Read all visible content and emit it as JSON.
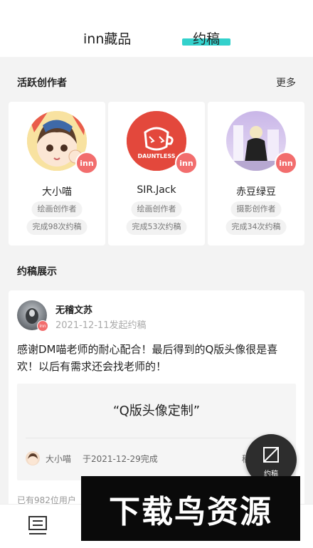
{
  "header": {
    "tabs": [
      {
        "label": "inn藏品"
      },
      {
        "label": "约稿"
      }
    ]
  },
  "active_creators": {
    "title": "活跃创作者",
    "more": "更多",
    "badge": "inn",
    "items": [
      {
        "name": "大小喵",
        "role": "绘画创作者",
        "count": "完成98次约稿"
      },
      {
        "name": "SIR.Jack",
        "role": "绘画创作者",
        "count": "完成53次约稿",
        "avatar_text": "DAUNTLESS"
      },
      {
        "name": "赤豆绿豆",
        "role": "摄影创作者",
        "count": "完成34次约稿"
      }
    ]
  },
  "showcase": {
    "title": "约稿展示",
    "post": {
      "author": "无稽文苏",
      "meta": "2021-12-11发起约稿",
      "badge": "inn",
      "text": "感谢DM喵老师的耐心配合！最后得到的Q版头像很是喜欢！以后有需求还会找老师的！",
      "product_title": "“Q版头像定制”",
      "artist": "大小喵",
      "completed": "于2021-12-29完成",
      "right_text": "稿",
      "footer": "已有982位用户"
    }
  },
  "fab": {
    "label": "约稿"
  },
  "watermark": {
    "text": "下载鸟资源"
  },
  "colors": {
    "accent": "#33d1cc",
    "badge": "#f26d6d",
    "fab": "#2d2d2d"
  }
}
